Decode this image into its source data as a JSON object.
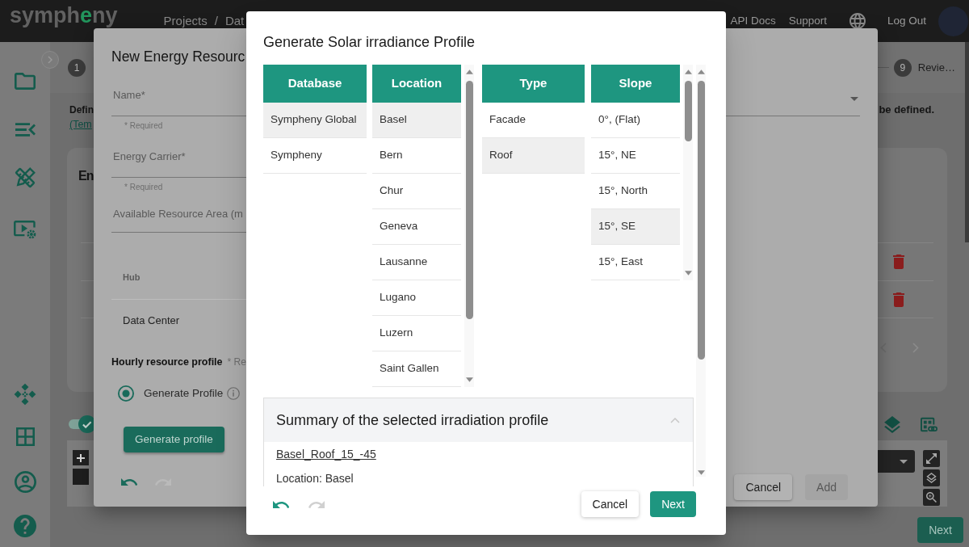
{
  "top_bar": {
    "logo": [
      {
        "text": "symph",
        "accent": false
      },
      {
        "text": "e",
        "accent": true
      },
      {
        "text": "ny",
        "accent": false
      }
    ],
    "breadcrumb": {
      "items": [
        "Projects",
        "Dat"
      ],
      "separator": "/"
    },
    "links": [
      "API Docs",
      "Support"
    ],
    "logout": "Log Out"
  },
  "stepper": {
    "steps": [
      {
        "number": "1"
      },
      {
        "number": "9",
        "label": "Revie…"
      }
    ]
  },
  "page": {
    "intro": {
      "text": "Defin",
      "link": "(Tem",
      "text_end": "be defined."
    },
    "card": {
      "title": "En"
    },
    "map_toggle": {
      "on": true
    },
    "next_button": "Next"
  },
  "resource_dialog": {
    "title": "New Energy Resourc",
    "fields": [
      {
        "label": "Name*",
        "helper": "* Required"
      },
      {
        "label": "Energy Carrier*",
        "helper": "* Required"
      },
      {
        "label": "Available Resource Area (m"
      }
    ],
    "hub_table": {
      "header": "Hub",
      "rows": [
        "Data Center"
      ]
    },
    "profile": {
      "title": "Hourly resource profile",
      "required": "* Re",
      "options": [
        {
          "label": "Generate Profile",
          "selected": true
        }
      ],
      "button": "Generate profile"
    },
    "history": {
      "undo_enabled": true,
      "redo_enabled": false
    },
    "buttons": [
      {
        "label": "Cancel",
        "disabled": false
      },
      {
        "label": "Add",
        "disabled": true
      }
    ]
  },
  "modal": {
    "title": "Generate Solar irradiance Profile",
    "columns": [
      {
        "header": "Database",
        "scrollbar": false,
        "items": [
          {
            "label": "Sympheny Global",
            "selected": true
          },
          {
            "label": "Sympheny",
            "selected": false
          }
        ]
      },
      {
        "header": "Location",
        "scrollbar": true,
        "items": [
          {
            "label": "Basel",
            "selected": true
          },
          {
            "label": "Bern",
            "selected": false
          },
          {
            "label": "Chur",
            "selected": false
          },
          {
            "label": "Geneva",
            "selected": false
          },
          {
            "label": "Lausanne",
            "selected": false
          },
          {
            "label": "Lugano",
            "selected": false
          },
          {
            "label": "Luzern",
            "selected": false
          },
          {
            "label": "Saint Gallen",
            "selected": false
          }
        ]
      },
      {
        "header": "Type",
        "scrollbar": false,
        "items": [
          {
            "label": "Facade",
            "selected": false
          },
          {
            "label": "Roof",
            "selected": true
          }
        ]
      },
      {
        "header": "Slope",
        "scrollbar": true,
        "items": [
          {
            "label": "0°, (Flat)",
            "selected": false
          },
          {
            "label": "15°, NE",
            "selected": false
          },
          {
            "label": "15°, North",
            "selected": false
          },
          {
            "label": "15°, SE",
            "selected": true
          },
          {
            "label": "15°, East",
            "selected": false
          }
        ]
      }
    ],
    "summary": {
      "title": "Summary of the selected irradiation profile",
      "expanded": true,
      "profile_name": "Basel_Roof_15_-45",
      "details": [
        "Location: Basel"
      ]
    },
    "history": {
      "undo_enabled": true,
      "redo_enabled": false
    },
    "buttons": [
      {
        "label": "Cancel",
        "kind": "secondary"
      },
      {
        "label": "Next",
        "kind": "primary"
      }
    ]
  }
}
